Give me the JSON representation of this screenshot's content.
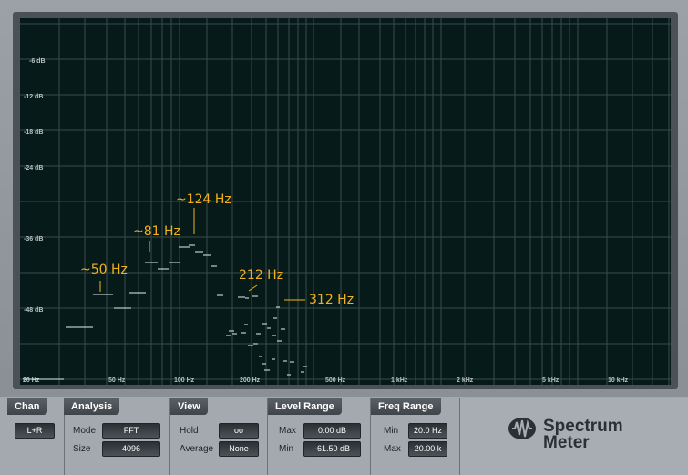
{
  "graph": {
    "db_ticks": [
      "-6 dB",
      "-12 dB",
      "-18 dB",
      "-24 dB",
      "-36 dB",
      "-48 dB"
    ],
    "freq_ticks": [
      "20 Hz",
      "50 Hz",
      "100 Hz",
      "200 Hz",
      "500 Hz",
      "1 kHz",
      "2 kHz",
      "5 kHz",
      "10 kHz"
    ],
    "annotations": [
      "~50 Hz",
      "~81 Hz",
      "~124 Hz",
      "212 Hz",
      "312 Hz"
    ],
    "colors": {
      "background": "#061a1a",
      "grid": "#3c4a4a",
      "bars": "#e8eeee",
      "annotation": "#f2b11c"
    }
  },
  "chan": {
    "title": "Chan",
    "button": "L+R"
  },
  "analysis": {
    "title": "Analysis",
    "mode_label": "Mode",
    "mode_value": "FFT",
    "size_label": "Size",
    "size_value": "4096"
  },
  "view": {
    "title": "View",
    "hold_label": "Hold",
    "hold_value": "oo",
    "average_label": "Average",
    "average_value": "None"
  },
  "level_range": {
    "title": "Level Range",
    "max_label": "Max",
    "max_value": "0.00 dB",
    "min_label": "Min",
    "min_value": "-61.50 dB"
  },
  "freq_range": {
    "title": "Freq Range",
    "min_label": "Min",
    "min_value": "20.0 Hz",
    "max_label": "Max",
    "max_value": "20.00 k"
  },
  "logo": {
    "line1": "Spectrum",
    "line2": "Meter",
    "icon": "presonus-waveform-icon"
  }
}
